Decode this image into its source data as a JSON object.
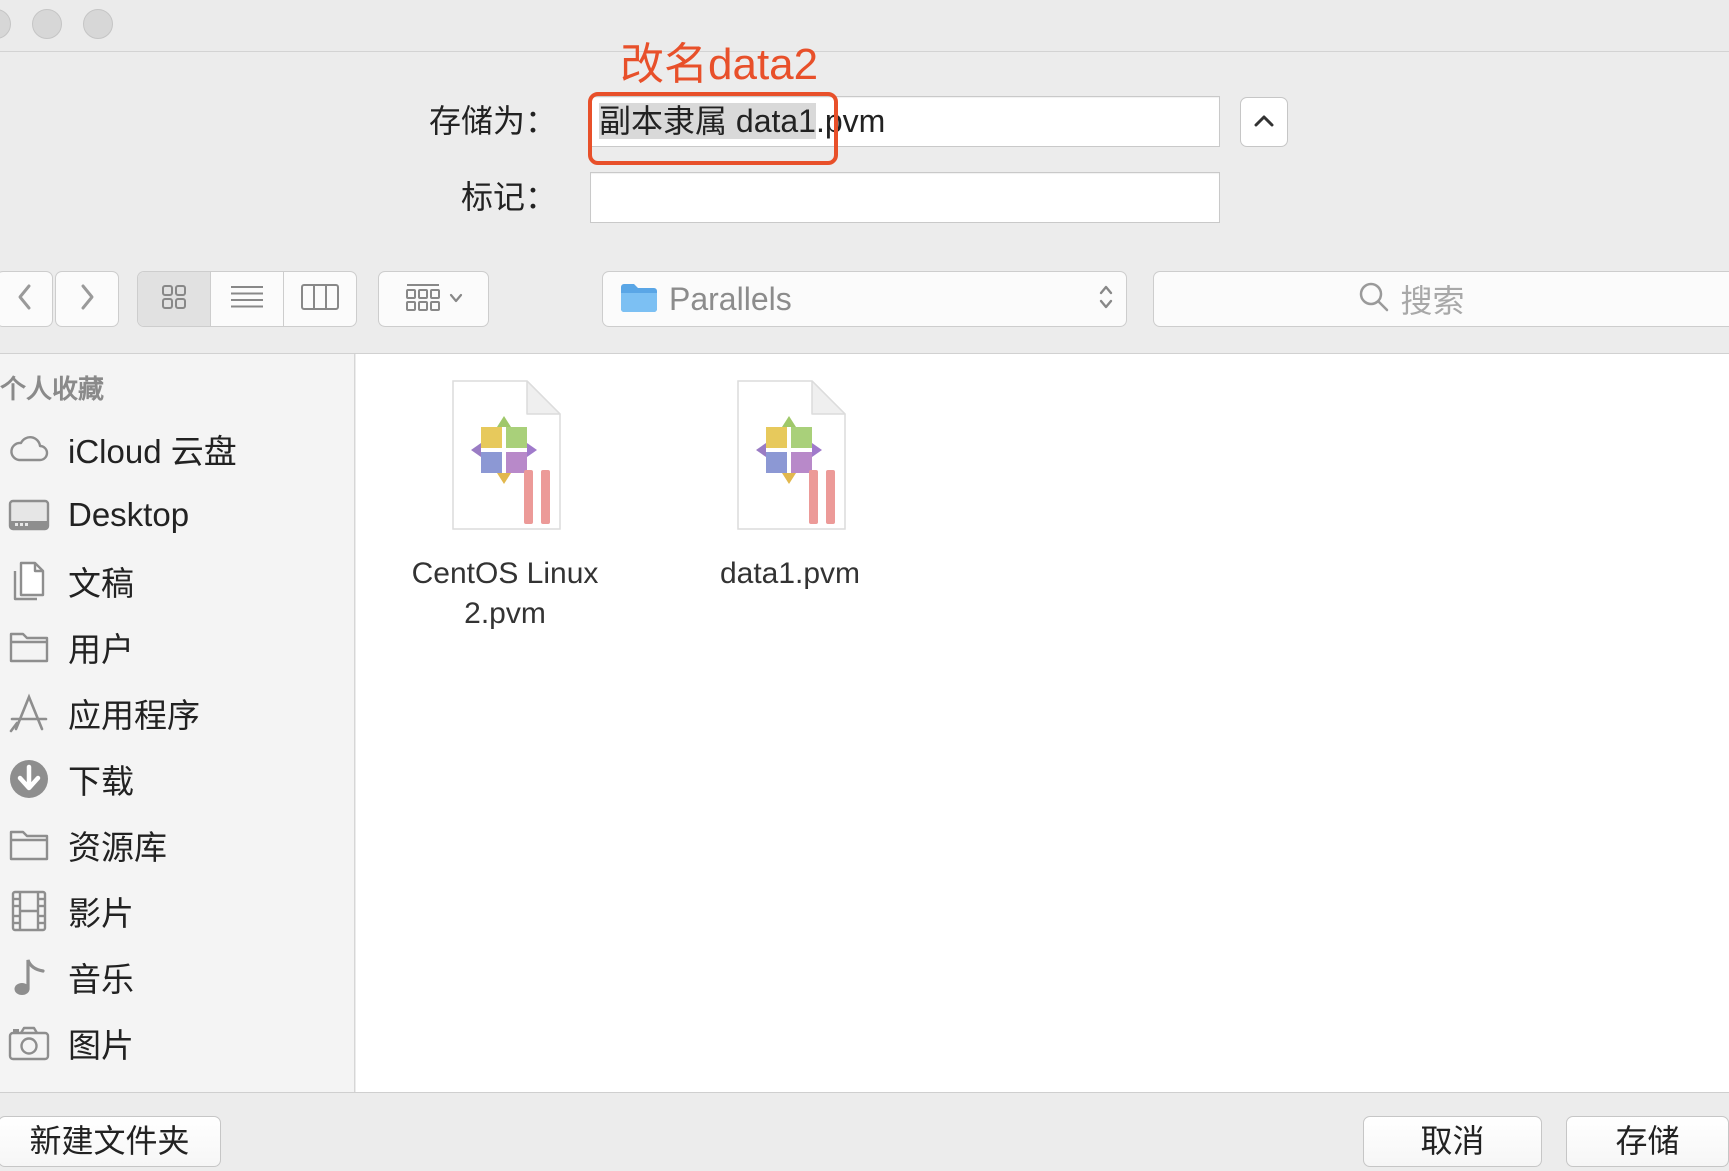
{
  "annotation": {
    "text": "改名data2"
  },
  "save_as": {
    "label": "存储为：",
    "selected_text": "副本隶属 data1",
    "rest_text": ".pvm"
  },
  "tags": {
    "label": "标记：",
    "value": ""
  },
  "expand_button": {
    "icon": "chevron-up-icon"
  },
  "toolbar": {
    "back_icon": "chevron-left-icon",
    "forward_icon": "chevron-right-icon",
    "view_modes": [
      {
        "icon": "icon-view-icon",
        "selected": true
      },
      {
        "icon": "list-view-icon",
        "selected": false
      },
      {
        "icon": "column-view-icon",
        "selected": false
      }
    ],
    "group_icon": "group-by-icon"
  },
  "location": {
    "label": "Parallels",
    "icon": "folder-icon"
  },
  "search": {
    "placeholder": "搜索",
    "icon": "search-icon"
  },
  "sidebar": {
    "heading": "个人收藏",
    "items": [
      {
        "label": "iCloud 云盘",
        "icon": "cloud-icon"
      },
      {
        "label": "Desktop",
        "icon": "desktop-icon"
      },
      {
        "label": "文稿",
        "icon": "documents-icon"
      },
      {
        "label": "用户",
        "icon": "folder-icon"
      },
      {
        "label": "应用程序",
        "icon": "applications-icon"
      },
      {
        "label": "下载",
        "icon": "download-icon"
      },
      {
        "label": "资源库",
        "icon": "folder-icon"
      },
      {
        "label": "影片",
        "icon": "film-icon"
      },
      {
        "label": "音乐",
        "icon": "music-note-icon"
      },
      {
        "label": "图片",
        "icon": "camera-icon"
      }
    ]
  },
  "files": [
    {
      "name": "CentOS Linux 2.pvm",
      "icon": "parallels-vm-file-icon"
    },
    {
      "name": "data1.pvm",
      "icon": "parallels-vm-file-icon"
    }
  ],
  "buttons": {
    "new_folder": "新建文件夹",
    "cancel": "取消",
    "save": "存储"
  },
  "colors": {
    "annotation": "#e8502a",
    "folder_blue": "#6cb4ee",
    "selection": "#d9d9d9",
    "sidebar_bg": "#f4f4f4",
    "dialog_bg": "#ececec"
  }
}
